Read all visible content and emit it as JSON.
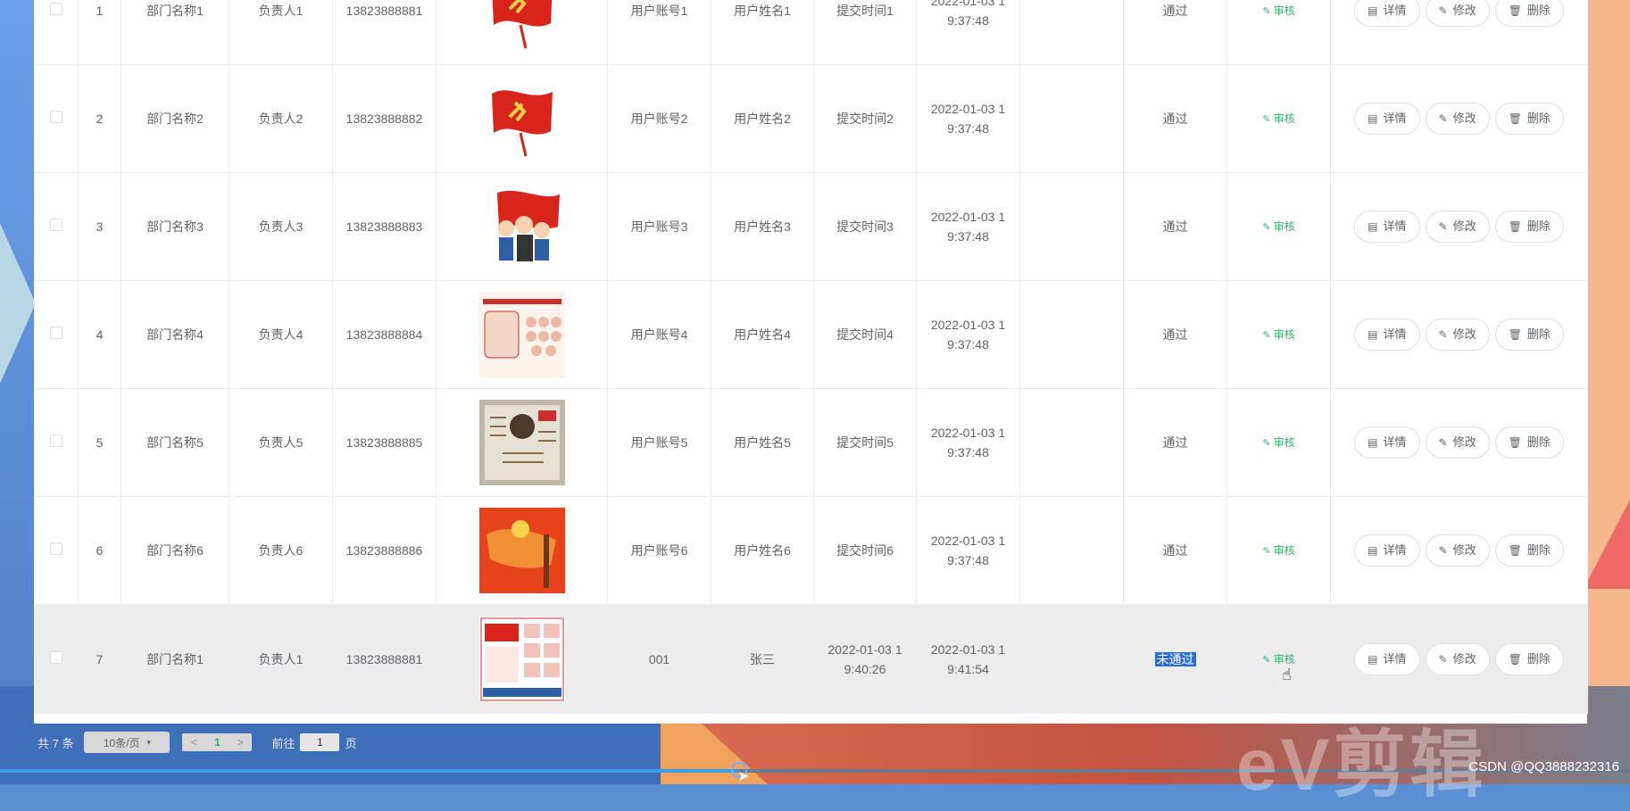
{
  "rows": [
    {
      "index": "1",
      "dept": "部门名称1",
      "leader": "负责人1",
      "phone": "13823888881",
      "account": "用户账号1",
      "name": "用户姓名1",
      "submit": "提交时间1",
      "time": "2022-01-03 1\n9:37:48",
      "reply": "",
      "status": "通过",
      "thumb": "flag"
    },
    {
      "index": "2",
      "dept": "部门名称2",
      "leader": "负责人2",
      "phone": "13823888882",
      "account": "用户账号2",
      "name": "用户姓名2",
      "submit": "提交时间2",
      "time": "2022-01-03 1\n9:37:48",
      "reply": "",
      "status": "通过",
      "thumb": "flag"
    },
    {
      "index": "3",
      "dept": "部门名称3",
      "leader": "负责人3",
      "phone": "13823888883",
      "account": "用户账号3",
      "name": "用户姓名3",
      "submit": "提交时间3",
      "time": "2022-01-03 1\n9:37:48",
      "reply": "",
      "status": "通过",
      "thumb": "cartoon"
    },
    {
      "index": "4",
      "dept": "部门名称4",
      "leader": "负责人4",
      "phone": "13823888884",
      "account": "用户账号4",
      "name": "用户姓名4",
      "submit": "提交时间4",
      "time": "2022-01-03 1\n9:37:48",
      "reply": "",
      "status": "通过",
      "thumb": "poster"
    },
    {
      "index": "5",
      "dept": "部门名称5",
      "leader": "负责人5",
      "phone": "13823888885",
      "account": "用户账号5",
      "name": "用户姓名5",
      "submit": "提交时间5",
      "time": "2022-01-03 1\n9:37:48",
      "reply": "",
      "status": "通过",
      "thumb": "board"
    },
    {
      "index": "6",
      "dept": "部门名称6",
      "leader": "负责人6",
      "phone": "13823888886",
      "account": "用户账号6",
      "name": "用户姓名6",
      "submit": "提交时间6",
      "time": "2022-01-03 1\n9:37:48",
      "reply": "",
      "status": "通过",
      "thumb": "map"
    },
    {
      "index": "7",
      "dept": "部门名称1",
      "leader": "负责人1",
      "phone": "13823888881",
      "account": "001",
      "name": "张三",
      "submit": "2022-01-03 1\n9:40:26",
      "time": "2022-01-03 1\n9:41:54",
      "reply": "",
      "status": "未通过",
      "thumb": "poster2",
      "highlight": true
    }
  ],
  "actions": {
    "review": "审核",
    "detail": "详情",
    "edit": "修改",
    "delete": "删除"
  },
  "icons": {
    "review": "pen-icon",
    "detail": "document-icon",
    "edit": "pen-icon",
    "delete": "trash-icon"
  },
  "pager": {
    "total": "共 7 条",
    "page_size": "10条/页",
    "current": "1",
    "prev": "<",
    "next": ">",
    "goto_prefix": "前往",
    "goto_value": "1",
    "goto_suffix": "页"
  },
  "watermark": "eV剪辑",
  "csdn": "CSDN @QQ3888232316",
  "colors": {
    "accent_green": "#2fb36a",
    "highlight_row": "#ececec",
    "selection": "#2b6fd6"
  }
}
